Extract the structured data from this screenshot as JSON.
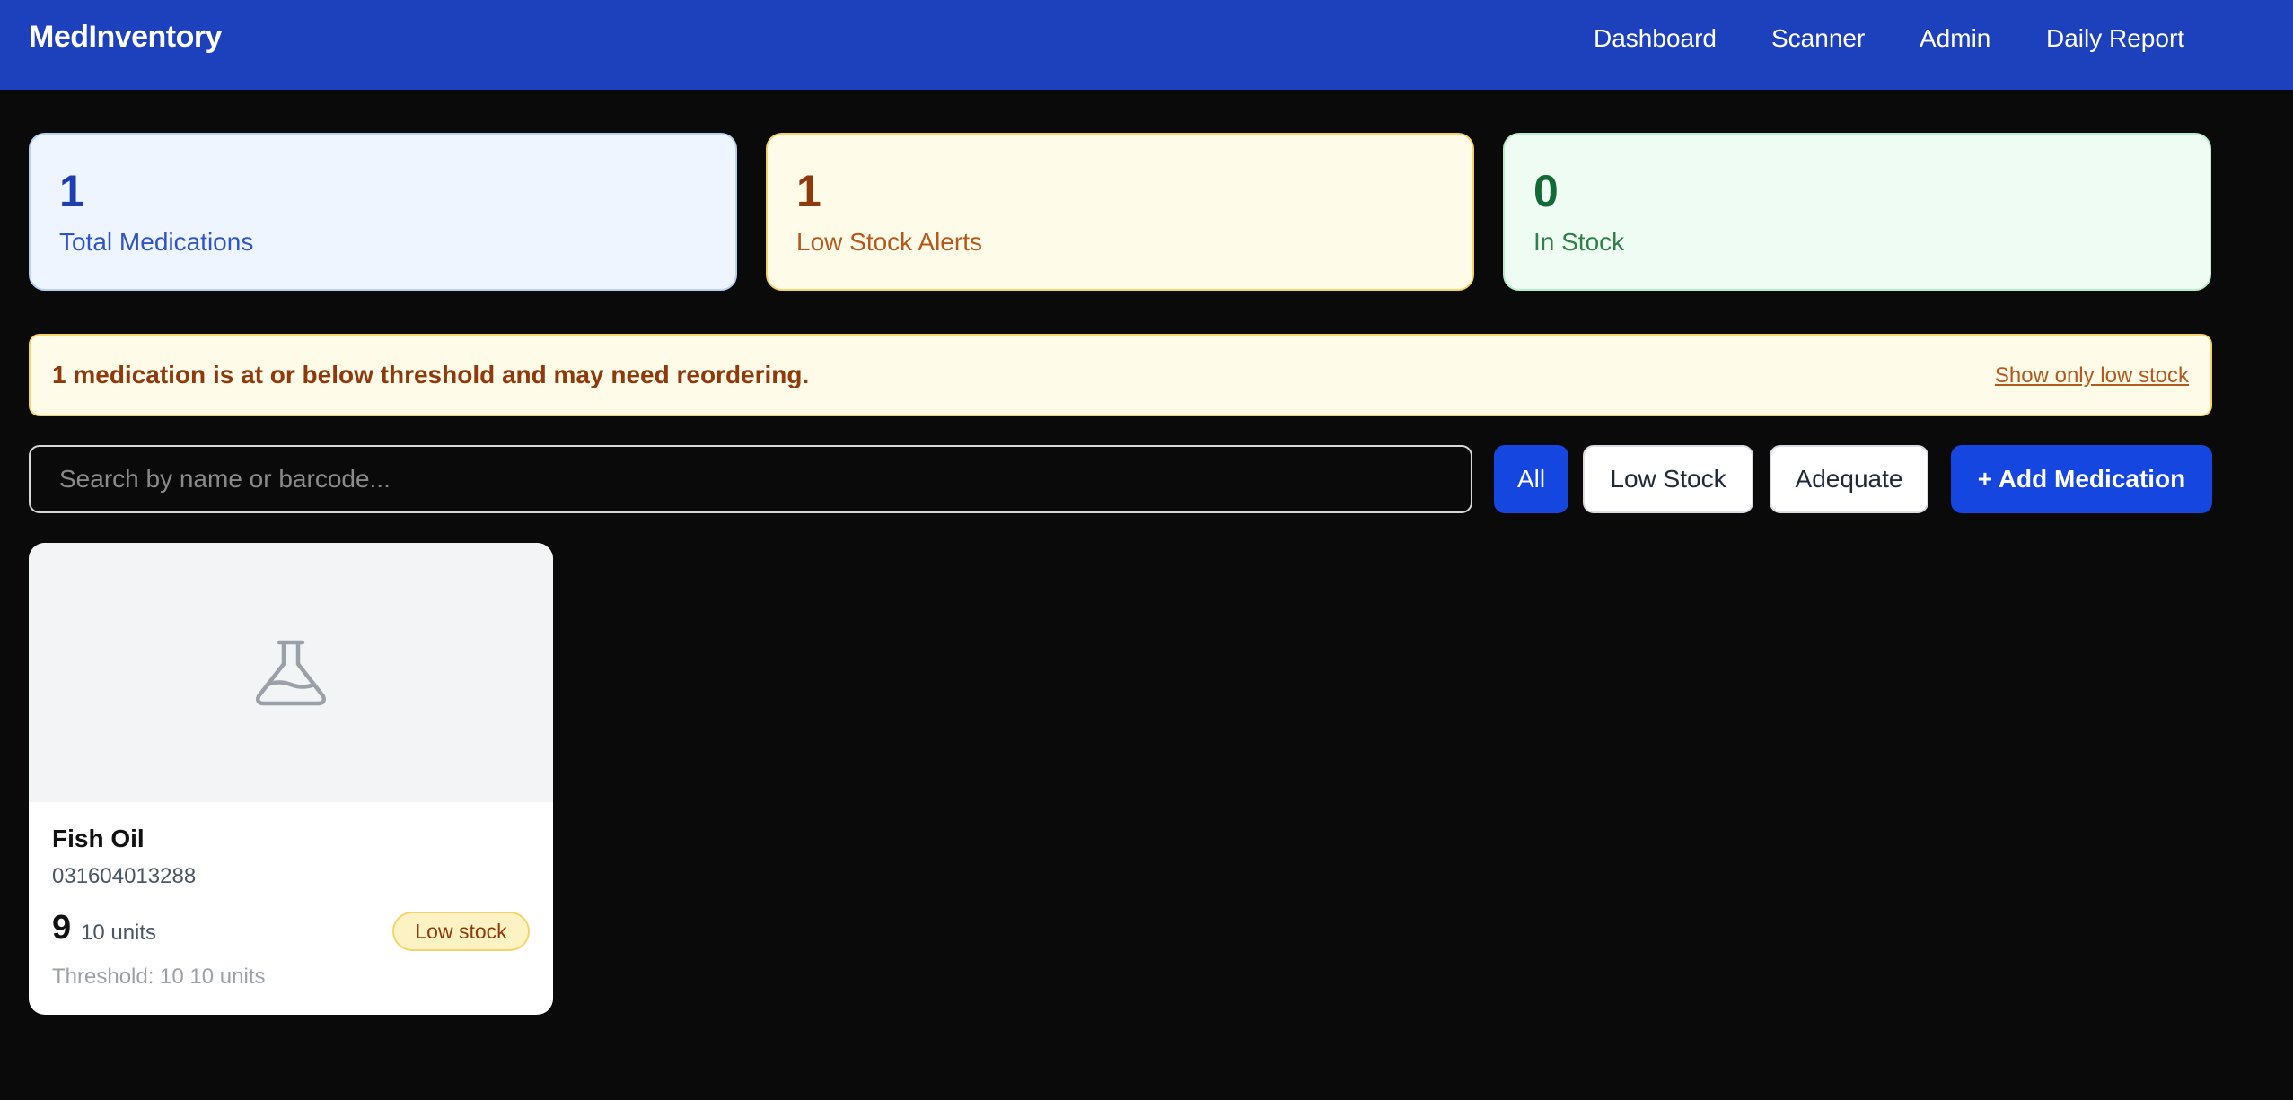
{
  "app": {
    "title": "MedInventory"
  },
  "nav": {
    "dashboard": "Dashboard",
    "scanner": "Scanner",
    "admin": "Admin",
    "daily_report": "Daily Report"
  },
  "stats": {
    "total": {
      "value": "1",
      "label": "Total Medications",
      "color": "#1d3fb0"
    },
    "low": {
      "value": "1",
      "label": "Low Stock Alerts",
      "color": "#8f3a0c"
    },
    "in_stock": {
      "value": "0",
      "label": "In Stock",
      "color": "#126a35"
    }
  },
  "alert": {
    "message": "1 medication is at or below threshold and may need reordering.",
    "action": "Show only low stock"
  },
  "search": {
    "placeholder": "Search by name or barcode..."
  },
  "filters": {
    "all": "All",
    "low_stock": "Low Stock",
    "adequate": "Adequate",
    "selected": "All"
  },
  "add_button": "+ Add Medication",
  "medications": [
    {
      "icon": "flask-icon",
      "name": "Fish Oil",
      "barcode": "031604013288",
      "quantity": "9",
      "unit": "10 units",
      "status": "Low stock",
      "threshold": "Threshold: 10 10 units"
    }
  ],
  "colors": {
    "nav_bg": "#1d40bd",
    "accent": "#1546e0",
    "background": "#0a0a0a",
    "warning": "#f4d46a"
  }
}
